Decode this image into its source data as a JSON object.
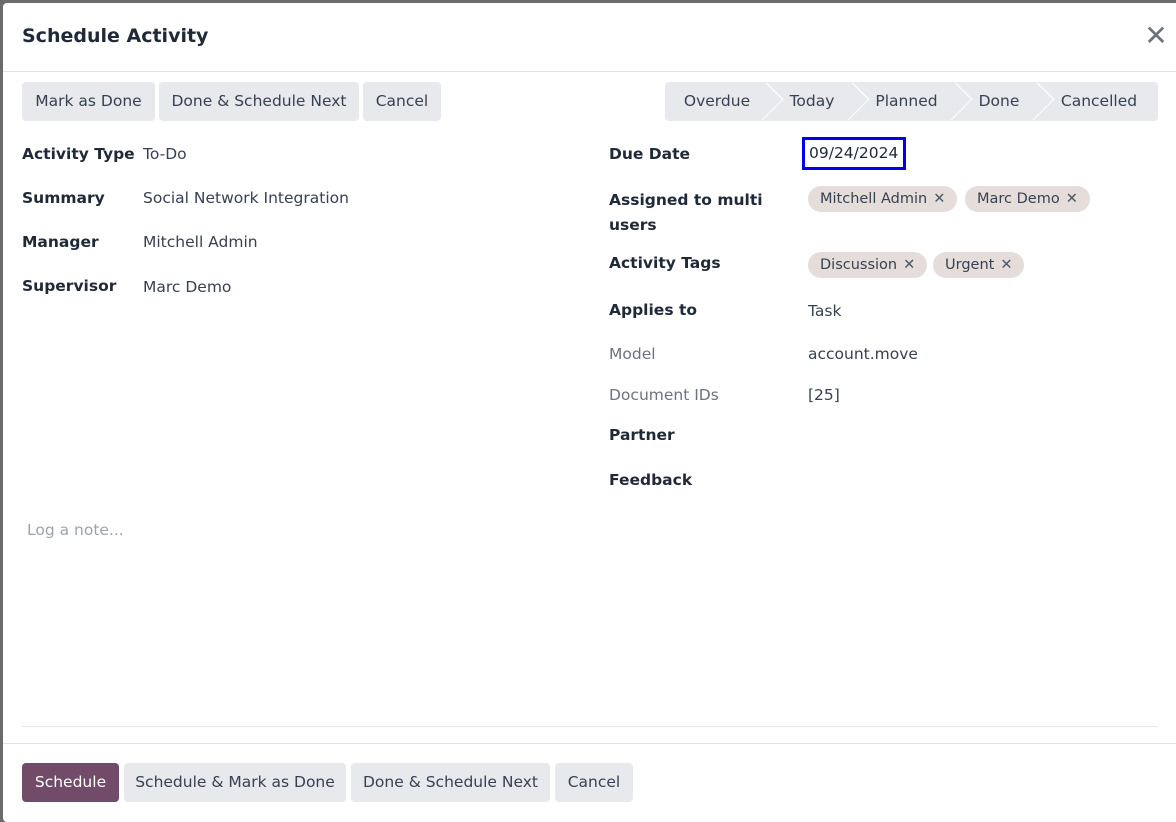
{
  "dialog": {
    "title": "Schedule Activity",
    "close_icon": "close-icon"
  },
  "top_buttons": {
    "mark_done": "Mark as Done",
    "done_next": "Done & Schedule Next",
    "cancel": "Cancel"
  },
  "status_bar": [
    "Overdue",
    "Today",
    "Planned",
    "Done",
    "Cancelled"
  ],
  "left_fields": [
    {
      "label": "Activity Type",
      "value": "To-Do"
    },
    {
      "label": "Summary",
      "value": "Social Network Integration"
    },
    {
      "label": "Manager",
      "value": "Mitchell Admin"
    },
    {
      "label": "Supervisor",
      "value": "Marc Demo"
    }
  ],
  "right_fields": {
    "due_date": {
      "label": "Due Date",
      "value": "09/24/2024"
    },
    "assigned": {
      "label": "Assigned to multi users",
      "tags": [
        "Mitchell Admin",
        "Marc Demo"
      ]
    },
    "tags": {
      "label": "Activity Tags",
      "tags": [
        "Discussion",
        "Urgent"
      ]
    },
    "applies_to": {
      "label": "Applies to",
      "value": "Task"
    },
    "model": {
      "label": "Model",
      "value": "account.move"
    },
    "doc_ids": {
      "label": "Document IDs",
      "value": "[25]"
    },
    "partner": {
      "label": "Partner"
    },
    "feedback": {
      "label": "Feedback"
    }
  },
  "note": {
    "placeholder": "Log a note..."
  },
  "footer": {
    "schedule": "Schedule",
    "schedule_done": "Schedule & Mark as Done",
    "done_next": "Done & Schedule Next",
    "cancel": "Cancel"
  },
  "colors": {
    "primary": "#714b67",
    "focus": "#0000ee",
    "tag_bg": "#e5ddda"
  }
}
